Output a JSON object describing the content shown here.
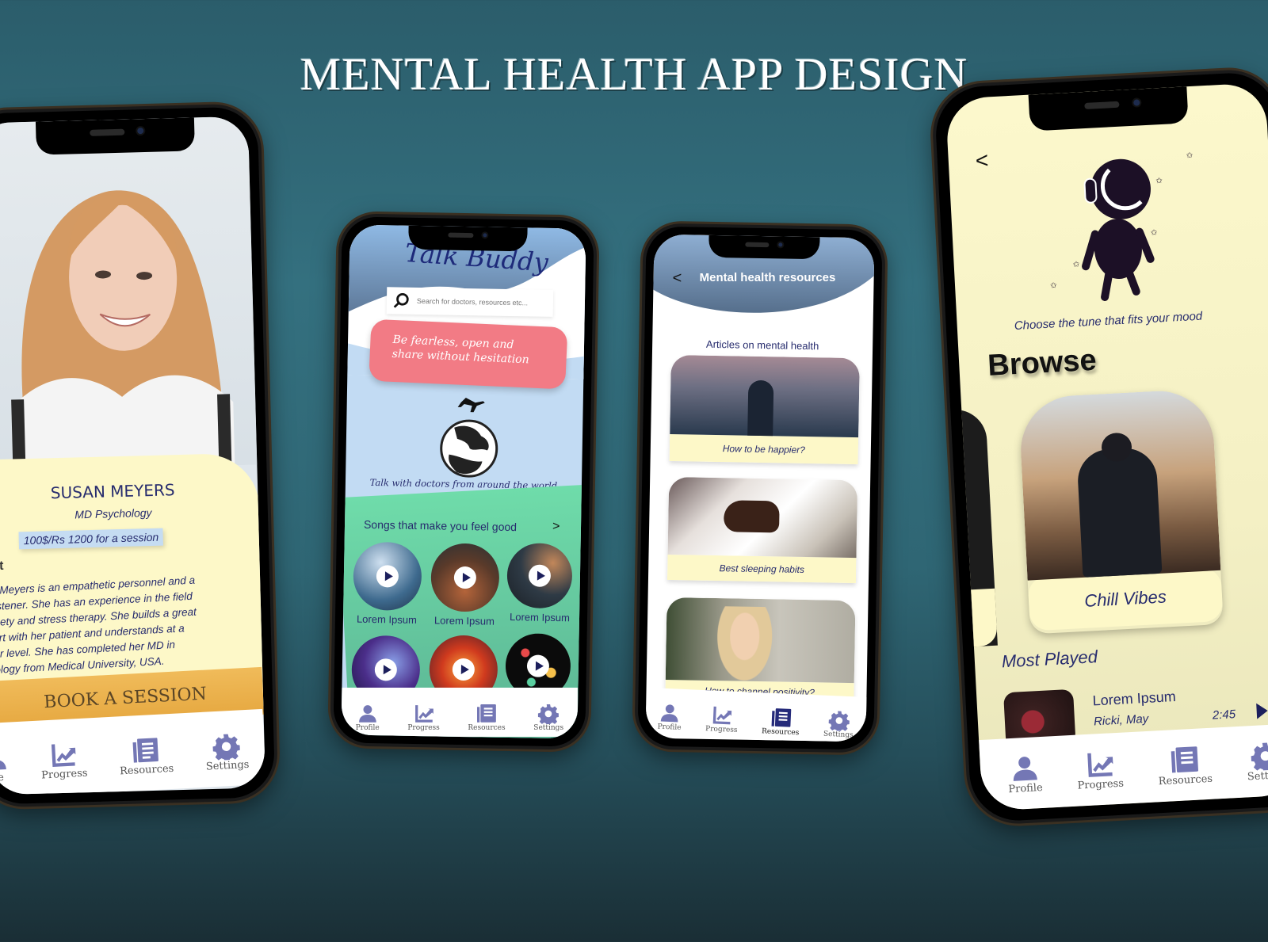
{
  "title": "MENTAL HEALTH APP DESIGN",
  "colors": {
    "background": "#2f6674",
    "navy_text": "#272c6e",
    "nav_icon": "#7477b5",
    "nav_icon_active": "#252a7a",
    "cream": "#fdf8c8",
    "pink_banner": "#f27b85",
    "green_section": "#6fdcaa",
    "light_blue": "#c2dbf3",
    "book_button": "#ebb24e"
  },
  "nav": [
    {
      "label": "Profile",
      "icon": "person-icon"
    },
    {
      "label": "Progress",
      "icon": "chart-icon"
    },
    {
      "label": "Resources",
      "icon": "document-icon"
    },
    {
      "label": "Settings",
      "icon": "gear-icon"
    }
  ],
  "profile_screen": {
    "name": "SUSAN MEYERS",
    "degree": "MD Psychology",
    "price": "100$/Rs 1200 for a session",
    "about_heading": "out",
    "about_lines": [
      "an Meyers is an empathetic personnel and a",
      "t listener. She has an experience in the field",
      "nxiety and stress therapy. She builds a great",
      "port with her patient and understands at a",
      "per level. She has completed her MD in",
      "hology from Medical University, USA."
    ],
    "book_button": "BOOK A SESSION",
    "nav_labels": [
      "file",
      "Progress",
      "Resources",
      "Settings"
    ]
  },
  "home_screen": {
    "app_name": "Talk Buddy",
    "search_placeholder": "Search for doctors, resources etc...",
    "banner": "Be fearless, open and share without hesitation",
    "world_caption": "Talk with doctors from around the world",
    "songs_heading": "Songs that make you feel good",
    "songs_arrow": ">",
    "songs": [
      {
        "label": "Lorem Ipsum"
      },
      {
        "label": "Lorem Ipsum"
      },
      {
        "label": "Lorem Ipsum"
      },
      {
        "label": ""
      },
      {
        "label": ""
      },
      {
        "label": ""
      }
    ],
    "active_nav": "none"
  },
  "resources_screen": {
    "back": "<",
    "header": "Mental health resources",
    "section": "Articles on mental health",
    "articles": [
      {
        "caption": "How to be happier?"
      },
      {
        "caption": "Best sleeping habits"
      },
      {
        "caption": "How to channel positivity?"
      }
    ],
    "active_nav": "Resources"
  },
  "music_screen": {
    "back": "<",
    "tagline": "Choose the tune that fits your mood",
    "browse": "Browse",
    "playlist": "Chill Vibes",
    "most_played": "Most Played",
    "track": {
      "title": "Lorem Ipsum",
      "artist": "Ricki, May",
      "duration": "2:45"
    },
    "nav_labels": [
      "Profile",
      "Progress",
      "Resources",
      "Setting"
    ]
  }
}
